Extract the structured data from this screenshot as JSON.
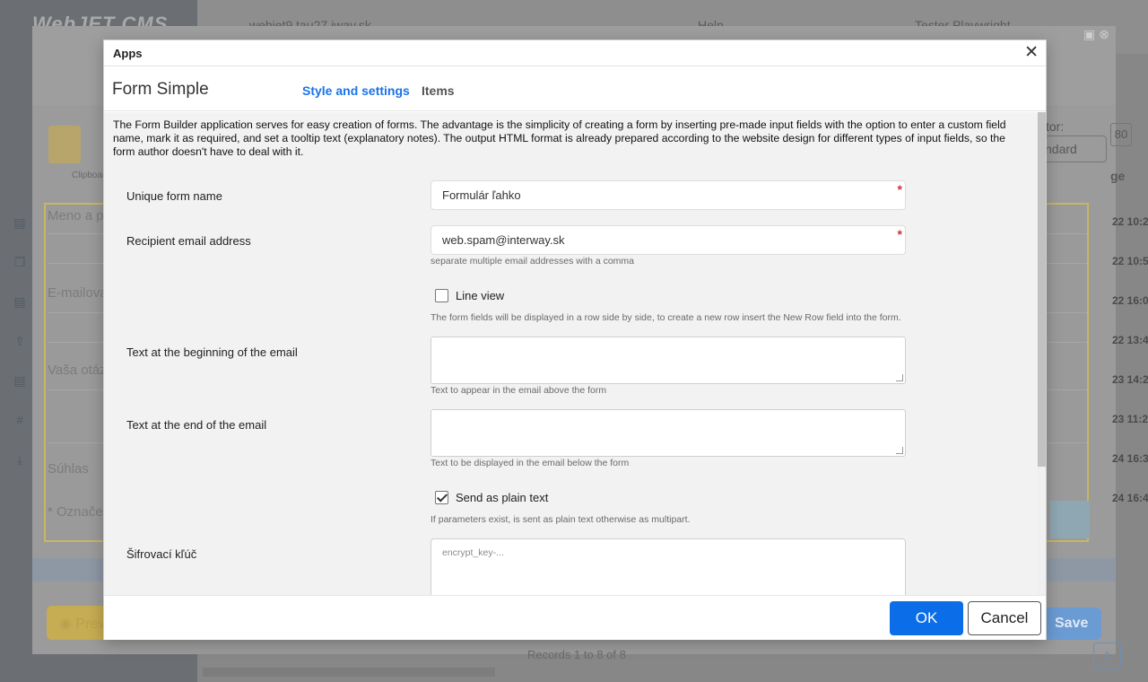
{
  "background": {
    "logo": "WebJET CMS",
    "topbar": {
      "domain": "webjet9.tau27.iway.sk",
      "help": "Help",
      "user": "Tester Playwright"
    },
    "editor_lines": [
      "Meno a p",
      "E-mailova",
      "Vaša otáz",
      "Súhlas",
      "* Označe"
    ],
    "clipboard_label": "Clipboard",
    "right_dates": [
      "22 10:2",
      "22 10:5",
      "22 16:0",
      "22 13:4",
      "23 14:2",
      "23 11:2",
      "24 16:3",
      "24 16:4"
    ],
    "editor_label": "tor:",
    "editor_select": "ndard",
    "age_label": "ge",
    "page_box": "80",
    "preview_label": "Prev",
    "save_label": "Save",
    "records_text": "Records 1 to 8 of 8",
    "page_number": "1"
  },
  "modal": {
    "title": "Apps",
    "app_name": "Form Simple",
    "tabs": [
      {
        "label": "Style and settings",
        "active": true
      },
      {
        "label": "Items",
        "active": false
      }
    ],
    "intro": "The Form Builder application serves for easy creation of forms. The advantage is the simplicity of creating a form by inserting pre-made input fields with the option to enter a custom field name, mark it as required, and set a tooltip text (explanatory notes). The output HTML format is already prepared according to the website design for different types of input fields, so the form author doesn't have to deal with it.",
    "fields": {
      "form_name": {
        "label": "Unique form name",
        "value": "Formulár ľahko",
        "required_mark": "*"
      },
      "recipient": {
        "label": "Recipient email address",
        "value": "web.spam@interway.sk",
        "required_mark": "*",
        "help": "separate multiple email addresses with a comma"
      },
      "line_view": {
        "label": "Line view",
        "checked": false,
        "help": "The form fields will be displayed in a row side by side, to create a new row insert the New Row field into the form."
      },
      "text_begin": {
        "label": "Text at the beginning of the email",
        "value": "",
        "help": "Text to appear in the email above the form"
      },
      "text_end": {
        "label": "Text at the end of the email",
        "value": "",
        "help": "Text to be displayed in the email below the form"
      },
      "plain_text": {
        "label": "Send as plain text",
        "checked": true,
        "help": "If parameters exist, is sent as plain text otherwise as multipart."
      },
      "encrypt_key": {
        "label": "Šifrovací kľúč",
        "placeholder": "encrypt_key-..."
      }
    },
    "buttons": {
      "ok": "OK",
      "cancel": "Cancel"
    }
  },
  "colors": {
    "accent": "#0b6ee8",
    "tab_active": "#1a73e8",
    "required": "#d32f2f"
  }
}
